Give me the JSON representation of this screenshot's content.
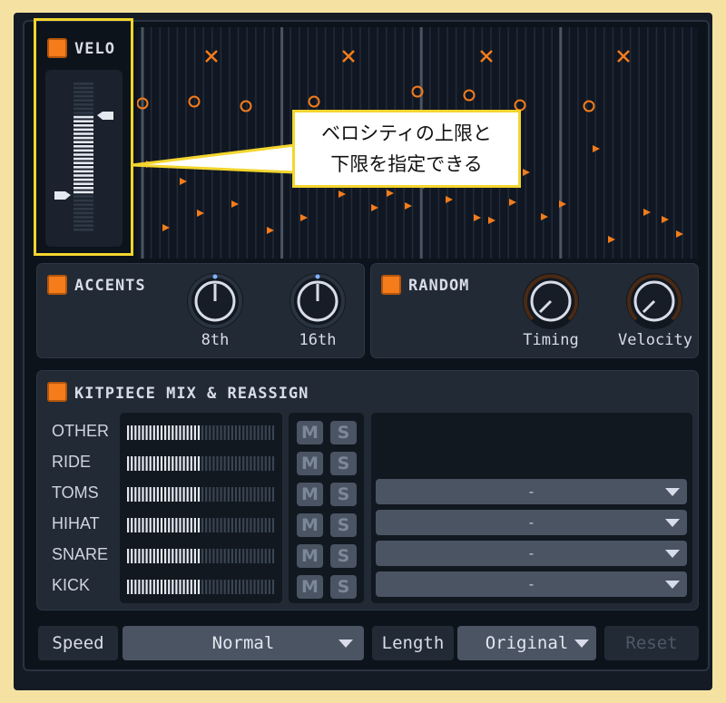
{
  "velo": {
    "title": "VELO",
    "callout_line1": "ベロシティの上限と",
    "callout_line2": "下限を指定できる"
  },
  "accents": {
    "title": "ACCENTS",
    "knobs": [
      {
        "label": "8th"
      },
      {
        "label": "16th"
      }
    ]
  },
  "random": {
    "title": "RANDOM",
    "knobs": [
      {
        "label": "Timing"
      },
      {
        "label": "Velocity"
      }
    ]
  },
  "kitpiece": {
    "title": "KITPIECE MIX & REASSIGN",
    "rows": [
      {
        "label": "OTHER",
        "mute": "M",
        "solo": "S"
      },
      {
        "label": "RIDE",
        "mute": "M",
        "solo": "S",
        "assign": "-"
      },
      {
        "label": "TOMS",
        "mute": "M",
        "solo": "S",
        "assign": "-"
      },
      {
        "label": "HIHAT",
        "mute": "M",
        "solo": "S",
        "assign": "-"
      },
      {
        "label": "SNARE",
        "mute": "M",
        "solo": "S",
        "assign": "-"
      },
      {
        "label": "KICK",
        "mute": "M",
        "solo": "S"
      }
    ]
  },
  "bottom": {
    "speed_label": "Speed",
    "speed_value": "Normal",
    "length_label": "Length",
    "length_value": "Original",
    "reset_label": "Reset"
  },
  "colors": {
    "accent": "#f47c1b",
    "highlight": "#f3d52e",
    "panel": "#222a35"
  }
}
